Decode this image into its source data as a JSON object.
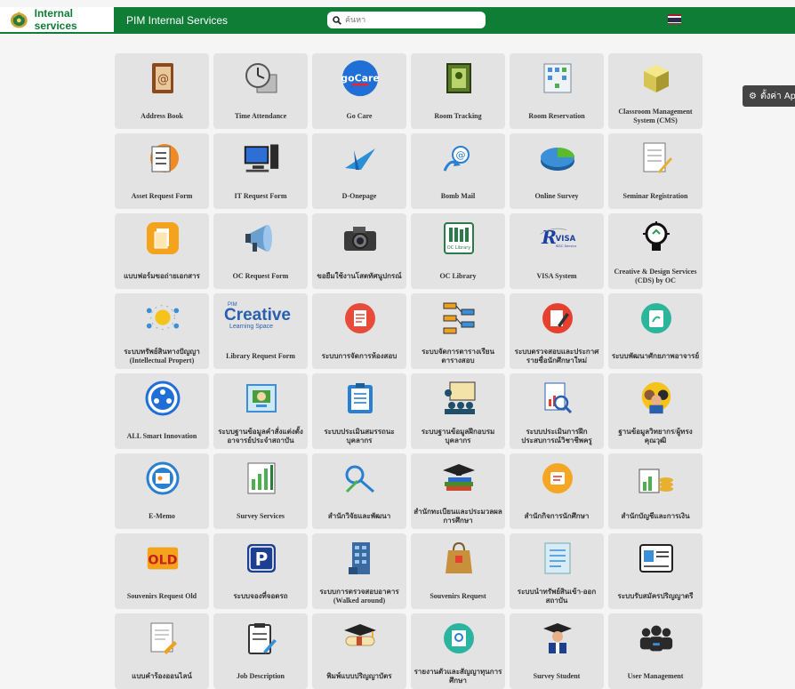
{
  "header": {
    "brand_label": "Internal services",
    "section_label": "PIM Internal Services",
    "search_placeholder": "ค้นหา",
    "settings_label": "ตั้งค่า App"
  },
  "tiles": [
    {
      "label": "Address Book",
      "icon": "address-book-icon"
    },
    {
      "label": "Time Attendance",
      "icon": "clock-calendar-icon"
    },
    {
      "label": "Go Care",
      "icon": "go-care-logo"
    },
    {
      "label": "Room Tracking",
      "icon": "room-frame-icon"
    },
    {
      "label": "Room Reservation",
      "icon": "floor-plan-icon"
    },
    {
      "label": "Classroom Management System (CMS)",
      "icon": "cube-icon"
    },
    {
      "label": "Asset Request Form",
      "icon": "clipboard-checklist-icon"
    },
    {
      "label": "IT Request Form",
      "icon": "computer-icon"
    },
    {
      "label": "D-Onepage",
      "icon": "paper-plane-icon"
    },
    {
      "label": "Bomb Mail",
      "icon": "email-arrow-icon"
    },
    {
      "label": "Online Survey",
      "icon": "pie-chart-icon"
    },
    {
      "label": "Seminar Registration",
      "icon": "notepad-pencil-icon"
    },
    {
      "label": "แบบฟอร์มขอถ่ายเอกสาร",
      "icon": "document-copy-icon"
    },
    {
      "label": "OC Request Form",
      "icon": "megaphone-icon"
    },
    {
      "label": "ขอยืมใช้งานโสตทัศนูปกรณ์",
      "icon": "camera-icon"
    },
    {
      "label": "OC Library",
      "icon": "library-books-icon"
    },
    {
      "label": "VISA System",
      "icon": "visa-logo"
    },
    {
      "label": "Creative & Design Services (CDS) by OC",
      "icon": "lightbulb-icon"
    },
    {
      "label": "ระบบทรัพย์สินทางปัญญา (Intellectual Propert)",
      "icon": "idea-bulb-icon"
    },
    {
      "label": "Library Request Form",
      "icon": "creative-learning-logo",
      "logo_top": "PIM",
      "logo_main": "Creative",
      "logo_sub": "Learning Space"
    },
    {
      "label": "ระบบการจัดการห้องสอบ",
      "icon": "exam-list-icon"
    },
    {
      "label": "ระบบจัดการตารางเรียน ตารางสอบ",
      "icon": "flowchart-icon"
    },
    {
      "label": "ระบบตรวจสอบและประกาศรายชื่อนักศึกษาใหม่",
      "icon": "edit-document-icon"
    },
    {
      "label": "ระบบพัฒนาศักยภาพอาจารย์",
      "icon": "growth-icon"
    },
    {
      "label": "ALL Smart Innovation",
      "icon": "network-people-icon"
    },
    {
      "label": "ระบบฐานข้อมูลคำสั่งแต่งตั้งอาจารย์ประจำสถาบัน",
      "icon": "certificate-icon"
    },
    {
      "label": "ระบบประเมินสมรรถนะบุคลากร",
      "icon": "evaluation-clipboard-icon"
    },
    {
      "label": "ระบบฐานข้อมูลฝึกอบรมบุคลากร",
      "icon": "training-icon"
    },
    {
      "label": "ระบบประเมินการฝึกประสบการณ์วิชาชีพครู",
      "icon": "search-report-icon"
    },
    {
      "label": "ฐานข้อมูลวิทยากร/ผู้ทรงคุณวุฒิ",
      "icon": "experts-icon"
    },
    {
      "label": "E-Memo",
      "icon": "memo-card-icon"
    },
    {
      "label": "Survey Services",
      "icon": "bar-chart-icon"
    },
    {
      "label": "สำนักวิจัยและพัฒนา",
      "icon": "research-tools-icon"
    },
    {
      "label": "สำนักทะเบียนและประมวลผลการศึกษา",
      "icon": "graduation-books-icon"
    },
    {
      "label": "สำนักกิจการนักศึกษา",
      "icon": "student-affairs-icon"
    },
    {
      "label": "สำนักบัญชีและการเงิน",
      "icon": "finance-icon"
    },
    {
      "label": "Souvenirs Request Old",
      "icon": "old-stamp-icon",
      "badge": "OLD"
    },
    {
      "label": "ระบบจองที่จอดรถ",
      "icon": "parking-icon",
      "badge": "P"
    },
    {
      "label": "ระบบการตรวจสอบอาคาร (Walked around)",
      "icon": "building-icon"
    },
    {
      "label": "Souvenirs Request",
      "icon": "gift-bag-icon"
    },
    {
      "label": "ระบบนำทรัพย์สินเข้า-ออก สถาบัน",
      "icon": "asset-list-icon"
    },
    {
      "label": "ระบบรับสมัครปริญญาตรี",
      "icon": "application-form-icon"
    },
    {
      "label": "แบบคำร้องออนไลน์",
      "icon": "request-document-icon"
    },
    {
      "label": "Job Description",
      "icon": "job-clipboard-icon"
    },
    {
      "label": "พิมพ์แบบปริญญาบัตร",
      "icon": "diploma-icon"
    },
    {
      "label": "รายงานตัวและสัญญาทุนการศึกษา",
      "icon": "scholarship-icon"
    },
    {
      "label": "Survey Student",
      "icon": "graduate-student-icon"
    },
    {
      "label": "User Management",
      "icon": "user-management-icon"
    }
  ],
  "colors": {
    "header_green": "#0f7d35",
    "tile_bg": "#e3e3e3",
    "page_bg": "#f5f5f5"
  }
}
